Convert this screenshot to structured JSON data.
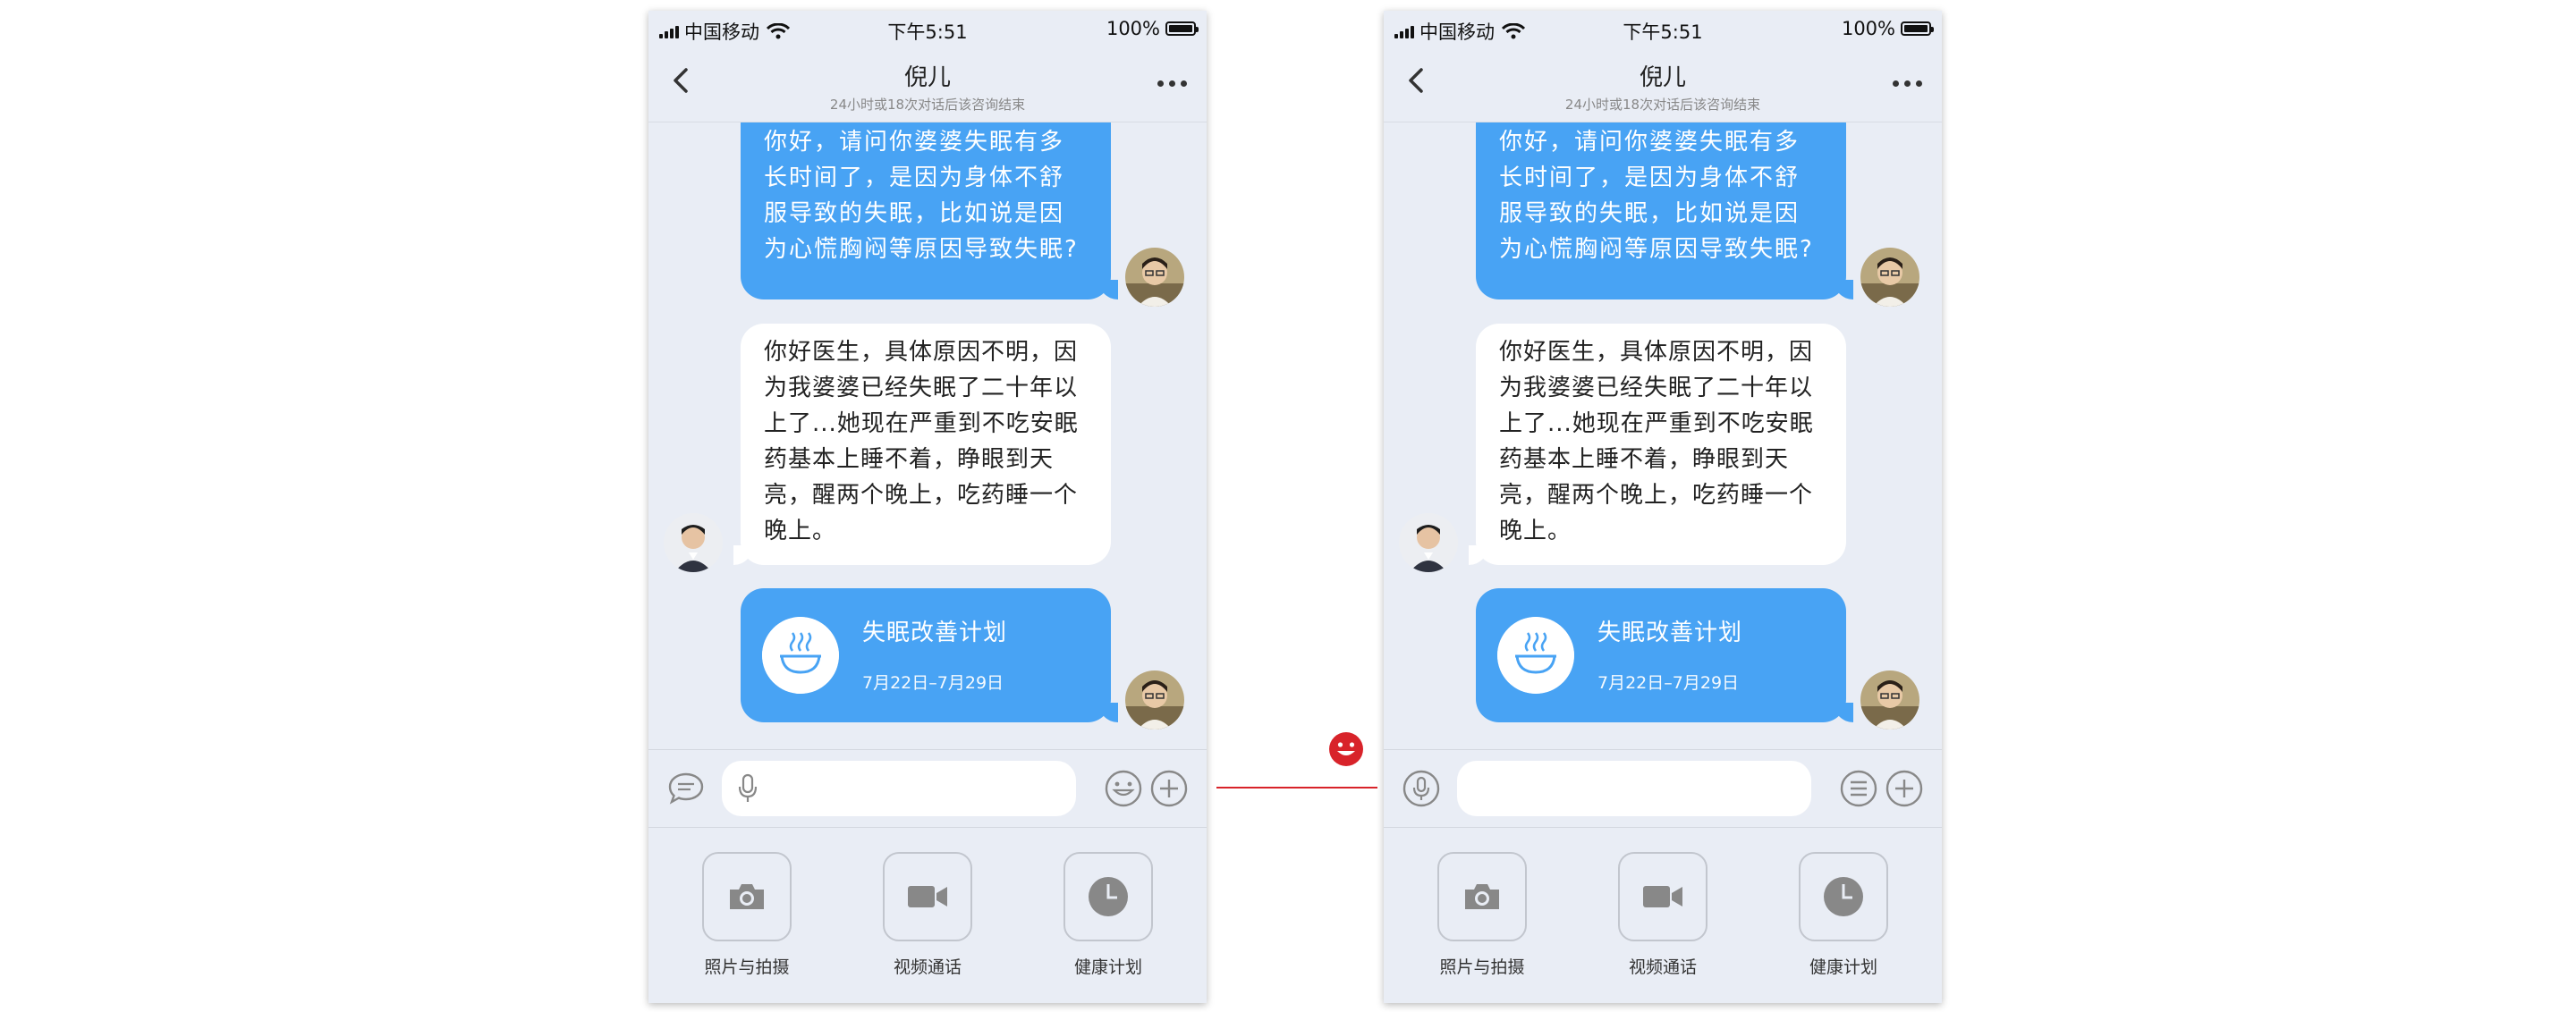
{
  "status_bar": {
    "carrier": "中国移动",
    "time": "下午5:51",
    "battery": "100%"
  },
  "nav": {
    "title": "倪儿",
    "subtitle": "24小时或18次对话后该咨询结束"
  },
  "messages": {
    "doctor_question": "你好，请问你婆婆失眠有多长时间了，是因为身体不舒服导致的失眠，比如说是因为心慌胸闷等原因导致失眠?",
    "patient_reply": "你好医生，具体原因不明，因为我婆婆已经失眠了二十年以上了...她现在严重到不吃安眠药基本上睡不着，睁眼到天亮，醒两个晚上，吃药睡一个晚上。",
    "plan_card": {
      "title": "失眠改善计划",
      "date_range": "7月22日–7月29日"
    }
  },
  "toolbar": {
    "items": [
      {
        "label": "照片与拍摄",
        "icon": "camera-icon"
      },
      {
        "label": "视频通话",
        "icon": "video-camera-icon"
      },
      {
        "label": "健康计划",
        "icon": "clock-icon"
      }
    ]
  },
  "colors": {
    "bubble_blue": "#48a3f4",
    "background": "#e9edf5",
    "connector_red": "#d8232a"
  }
}
